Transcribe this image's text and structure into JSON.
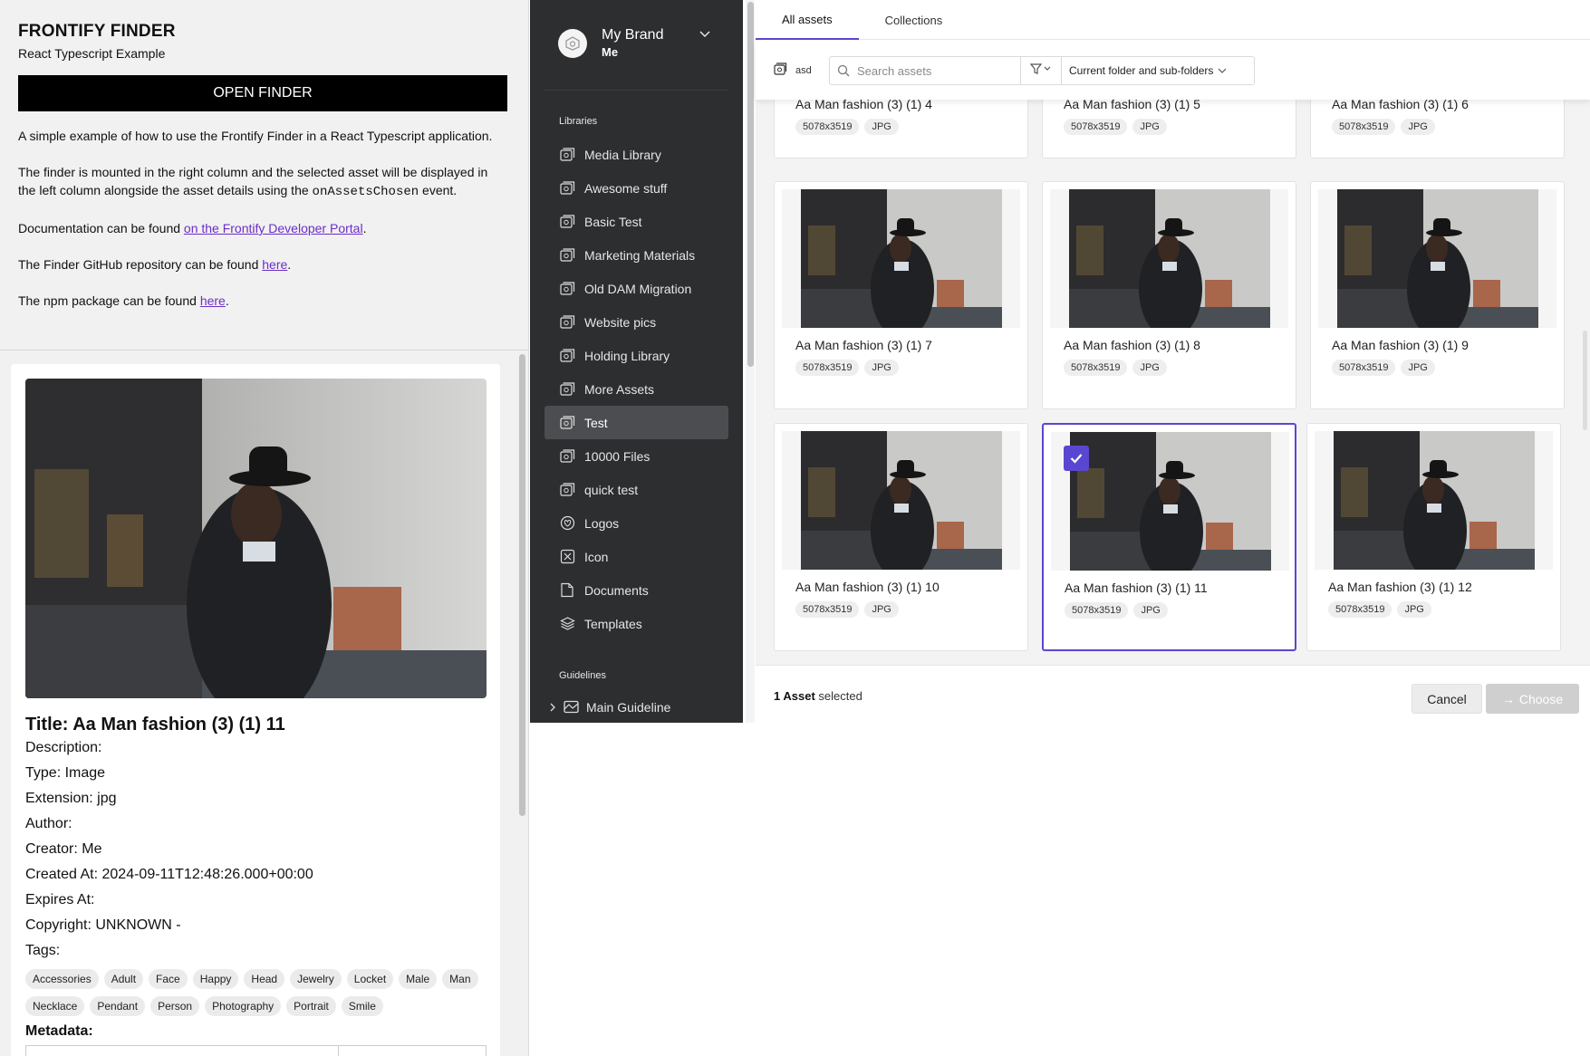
{
  "intro": {
    "title": "FRONTIFY FINDER",
    "subtitle": "React Typescript Example",
    "open_button": "OPEN FINDER",
    "p1": "A simple example of how to use the Frontify Finder in a React Typescript application.",
    "p2_before": "The finder is mounted in the right column and the selected asset will be displayed in the left column alongside the asset details using the ",
    "p2_code": "onAssetsChosen",
    "p2_after": " event.",
    "p3_before": "Documentation can be found ",
    "p3_link": "on the Frontify Developer Portal",
    "p3_after": ".",
    "p4_before": "The Finder GitHub repository can be found ",
    "p4_link": "here",
    "p4_after": ".",
    "p5_before": "The npm package can be found ",
    "p5_link": "here",
    "p5_after": "."
  },
  "details": {
    "title": "Title: Aa Man fashion (3) (1) 11",
    "description": "Description:",
    "type": "Type: Image",
    "extension": "Extension: jpg",
    "author": "Author:",
    "creator": "Creator: Me",
    "created_at": "Created At: 2024-09-11T12:48:26.000+00:00",
    "expires_at": "Expires At:",
    "copyright": "Copyright: UNKNOWN -",
    "tags_label": "Tags:",
    "tags": [
      "Accessories",
      "Adult",
      "Face",
      "Happy",
      "Head",
      "Jewelry",
      "Locket",
      "Male",
      "Man",
      "Necklace",
      "Pendant",
      "Person",
      "Photography",
      "Portrait",
      "Smile"
    ],
    "metadata_label": "Metadata:"
  },
  "sidebar": {
    "brand_name": "My Brand",
    "brand_user": "Me",
    "libraries_label": "Libraries",
    "libraries": [
      {
        "label": "Media Library",
        "icon": "media-library-icon"
      },
      {
        "label": "Awesome stuff",
        "icon": "media-library-icon"
      },
      {
        "label": "Basic Test",
        "icon": "media-library-icon"
      },
      {
        "label": "Marketing Materials",
        "icon": "media-library-icon"
      },
      {
        "label": "Old DAM Migration",
        "icon": "media-library-icon"
      },
      {
        "label": "Website pics",
        "icon": "media-library-icon"
      },
      {
        "label": "Holding Library",
        "icon": "media-library-icon"
      },
      {
        "label": "More Assets",
        "icon": "media-library-icon"
      },
      {
        "label": "Test",
        "icon": "media-library-icon",
        "active": true
      },
      {
        "label": "10000 Files",
        "icon": "media-library-icon"
      },
      {
        "label": "quick test",
        "icon": "media-library-icon"
      },
      {
        "label": "Logos",
        "icon": "logo-library-icon"
      },
      {
        "label": "Icon",
        "icon": "icon-library-icon"
      },
      {
        "label": "Documents",
        "icon": "document-library-icon"
      },
      {
        "label": "Templates",
        "icon": "template-library-icon"
      }
    ],
    "guidelines_label": "Guidelines",
    "guideline_item": "Main Guideline"
  },
  "finder": {
    "tabs": [
      "All assets",
      "Collections"
    ],
    "active_tab": 0,
    "folder_chip": "asd",
    "search_placeholder": "Search assets",
    "scope": "Current folder and sub-folders",
    "accent_color": "#5a47d1",
    "assets": [
      {
        "name": "Aa Man fashion (3) (1) 4",
        "dims": "5078x3519",
        "ext": "JPG"
      },
      {
        "name": "Aa Man fashion (3) (1) 5",
        "dims": "5078x3519",
        "ext": "JPG"
      },
      {
        "name": "Aa Man fashion (3) (1) 6",
        "dims": "5078x3519",
        "ext": "JPG"
      },
      {
        "name": "Aa Man fashion (3) (1) 7",
        "dims": "5078x3519",
        "ext": "JPG"
      },
      {
        "name": "Aa Man fashion (3) (1) 8",
        "dims": "5078x3519",
        "ext": "JPG"
      },
      {
        "name": "Aa Man fashion (3) (1) 9",
        "dims": "5078x3519",
        "ext": "JPG"
      },
      {
        "name": "Aa Man fashion (3) (1) 10",
        "dims": "5078x3519",
        "ext": "JPG"
      },
      {
        "name": "Aa Man fashion (3) (1) 11",
        "dims": "5078x3519",
        "ext": "JPG",
        "selected": true
      },
      {
        "name": "Aa Man fashion (3) (1) 12",
        "dims": "5078x3519",
        "ext": "JPG"
      }
    ],
    "selection_count": "1 Asset",
    "selection_suffix": " selected",
    "cancel_label": "Cancel",
    "choose_label": "Choose"
  }
}
